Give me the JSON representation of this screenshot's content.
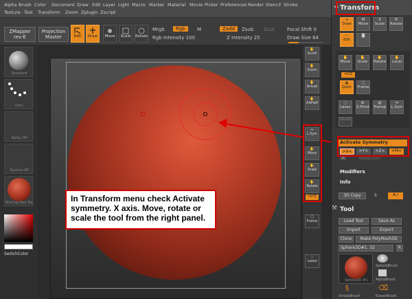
{
  "menubar": {
    "row1": [
      "Alpha",
      "Brush",
      "Color",
      "Document",
      "Draw",
      "Edit",
      "Layer",
      "Light",
      "Macro",
      "Marker",
      "Material",
      "Movie",
      "Picker",
      "Preferences",
      "Render",
      "Stencil",
      "Stroke"
    ],
    "row2": [
      "Texture",
      "Tool",
      "Transform",
      "Zoom",
      "Zplugin",
      "Zscript"
    ]
  },
  "toolshelf": {
    "zmapper": "ZMapper",
    "zmapper_sub": "rev-E",
    "projection": "Projection",
    "projection_sub": "Master",
    "edit": "Edit",
    "draw": "Draw",
    "move": "Move",
    "scale": "Scale",
    "rotate": "Rotate",
    "mrgb": "Mrgb",
    "rgb": "Rgb",
    "m": "M",
    "rgb_intensity": "Rgb Intensity 100",
    "zadd": "Zadd",
    "zsub": "Zsub",
    "zcut": "Zcut",
    "z_intensity": "Z Intensity 25",
    "focal_shift": "Focal Shift 0",
    "draw_size": "Draw Size 64"
  },
  "leftpanel": {
    "thumbs": [
      "Standard",
      "Dots",
      "Alpha Off",
      "Texture Off",
      "MatCap Red Wa"
    ],
    "switch_color": "SwitchColor"
  },
  "rightshelf": [
    "Scroll",
    "Zoom",
    "Actual",
    "AAHalf",
    "L.Sym",
    "Move",
    "Scale",
    "Rotate",
    "Frame",
    "Lasso"
  ],
  "rightshelf_xyz": "•XYZ",
  "transform_panel": {
    "title": "Transform",
    "btns_row1": [
      "Draw",
      "Move",
      "Scale",
      "Rotate"
    ],
    "btn_edit": "Edit",
    "btns_row2": [
      "Move",
      "Scale",
      "Rotate",
      "Local"
    ],
    "xyz": "•XYZ",
    "quick": "Quick",
    "frame": "Frame",
    "btns_row3": [
      "Lasso",
      "S.Pivot",
      "Transp",
      "L.Sym"
    ],
    "ghost": "Ghost",
    "activate_symmetry": "Activate Symmetry",
    "axes": [
      ">X<",
      ">Y<",
      ">Z<",
      ">M<"
    ],
    "rs": "(R)",
    "radial_count": "RadialCount",
    "modifiers": "Modifiers",
    "info": "Info",
    "copy3d": "3D Copy",
    "s": "S",
    "ai": "A.I"
  },
  "tool_panel": {
    "title": "Tool",
    "load": "Load Tool",
    "saveas": "Save As",
    "import": "Import",
    "export": "Export",
    "clone": "Clone",
    "make_polymesh": "Make PolyMesh3D",
    "current": "Sphere3D#1. 32",
    "r": "R",
    "thumb_label": "Sphere3D #1",
    "spherebrush": "SphereBrush",
    "alphabrush": "AlphaBrush",
    "simplebrush": "SimpleBrush",
    "erasebrush": "EraserBrush"
  },
  "annotation": "In Transform menu check Activate symmetry. X axis. Move, rotate or scale the tool from the right panel.",
  "colors": {
    "accent": "#e88a1d",
    "highlight_red": "#e00000"
  }
}
